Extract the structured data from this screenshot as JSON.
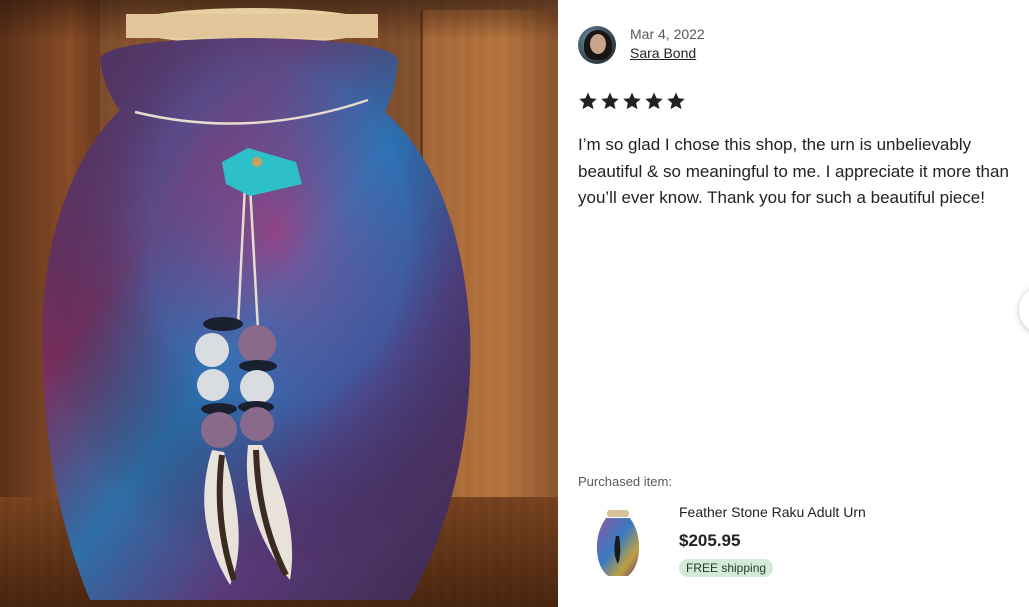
{
  "photo": {
    "icon": "review-photo-urn-image"
  },
  "review": {
    "date": "Mar 4, 2022",
    "reviewer_name": "Sara Bond",
    "rating": 5,
    "max_rating": 5,
    "star_color": "#222222",
    "text": "I’m so glad I chose this shop, the urn is unbelievably beautiful & so meaningful to me. I appreciate it more than you’ll ever know. Thank you for such a beautiful piece!"
  },
  "purchased": {
    "label": "Purchased item:",
    "product_title": "Feather Stone Raku Adult Urn",
    "price": "$205.95",
    "shipping_badge": "FREE shipping",
    "badge_color": "#d4e9d7"
  }
}
